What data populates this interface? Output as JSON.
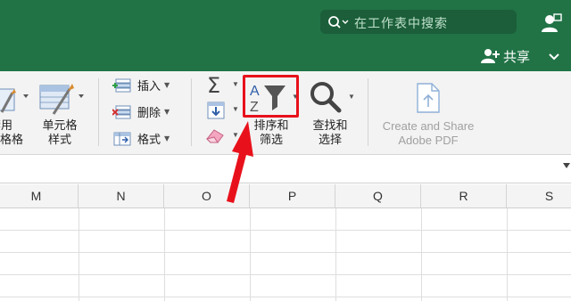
{
  "titlebar": {
    "search_placeholder": "在工作表中搜索",
    "share_label": "共享",
    "accent_color": "#217346"
  },
  "ribbon": {
    "partial_table_format_label_line1": "套用",
    "partial_table_format_label_line2": "表格格式",
    "cell_styles_label_line1": "单元格",
    "cell_styles_label_line2": "样式",
    "insert_label": "插入",
    "delete_label": "删除",
    "format_label": "格式",
    "sort_filter_label_line1": "排序和",
    "sort_filter_label_line2": "筛选",
    "find_select_label_line1": "查找和",
    "find_select_label_line2": "选择",
    "create_pdf_label_line1": "Create and Share",
    "create_pdf_label_line2": "Adobe PDF",
    "highlight_color": "#e8111b"
  },
  "grid": {
    "columns": [
      "M",
      "N",
      "O",
      "P",
      "Q",
      "R",
      "S"
    ]
  }
}
